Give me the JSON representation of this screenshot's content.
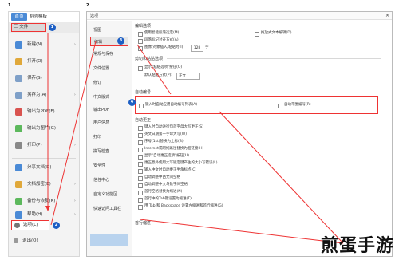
{
  "steps": {
    "one": "1.",
    "two": "2."
  },
  "left_panel": {
    "tabs": [
      "首页",
      "稻壳模板"
    ],
    "file_button": "三 文件",
    "items": [
      {
        "label": "新建(N)",
        "chevron": "›"
      },
      {
        "label": "打开(O)",
        "chevron": ""
      },
      {
        "label": "保存(S)",
        "chevron": ""
      },
      {
        "label": "另存为(A)",
        "chevron": "›"
      },
      {
        "label": "输出为PDF(F)",
        "chevron": ""
      },
      {
        "label": "输出为图片(G)",
        "chevron": ""
      },
      {
        "label": "打印(P)",
        "chevron": "›"
      },
      {
        "label": "分享文档(D)",
        "chevron": ""
      },
      {
        "label": "文档加密(E)",
        "chevron": "›"
      },
      {
        "label": "备份与恢复(K)",
        "chevron": "›"
      },
      {
        "label": "帮助(H)",
        "chevron": "›"
      }
    ],
    "options_button": "选项(L)",
    "exit_button": "退出(Q)"
  },
  "badges": {
    "one": "1",
    "two": "2",
    "three": "3",
    "four": "4"
  },
  "dialog": {
    "title": "选项",
    "close": "×",
    "nav": [
      "视图",
      "编辑",
      "常规与保存",
      "文件位置",
      "修订",
      "中文版式",
      "输出PDF",
      "用户信息",
      "打印",
      "拼写检查",
      "安全性",
      "信任中心",
      "自定义功能区",
      "快速访问工具栏"
    ],
    "sections": {
      "edit": "编辑选项",
      "paste": "剪切和粘贴选项",
      "autonum": "自动编号",
      "autocorrect": "自动更正",
      "chinese": "首行缩进"
    },
    "edit_options": [
      "使用智能段落选定(M)",
      "拖放式文本编辑(D)",
      "段落标记对齐方式(A)",
      "图像/对象插入/粘贴为(I)",
      "嵌入型"
    ],
    "paste_options": [
      "显示\"粘贴选项\"按钮(O)",
      "默认粘贴方式(P):",
      "正文"
    ],
    "autonum_options": [
      "键入时自动应用自动编号列表(A)",
      "自动带圈编号(R)"
    ],
    "autocorrect_options": [
      "键入时自动进行句首字母大写更正(S)",
      "英文日期第一字母大写(W)",
      "序号(1st)替换为上标(B)",
      "Internet或网络路径替换为超链接(H)",
      "显示\"自动更正选项\"按钮(U)",
      "更正意外使用大写锁定键产生的大小写错误(L)",
      "输入中文时自动更正半角标点(C)",
      "自动调整中西文间空格",
      "自动调整中文与数字间空格",
      "首行空格替换为缩进(N)",
      "首行中的Tab键设置为缩进(T)",
      "用 Tab 和 Backspace 设置左缩进和首行缩进(G)"
    ],
    "numbers": {
      "value": "128",
      "unit": "字"
    }
  },
  "watermark": "煎蛋手游"
}
